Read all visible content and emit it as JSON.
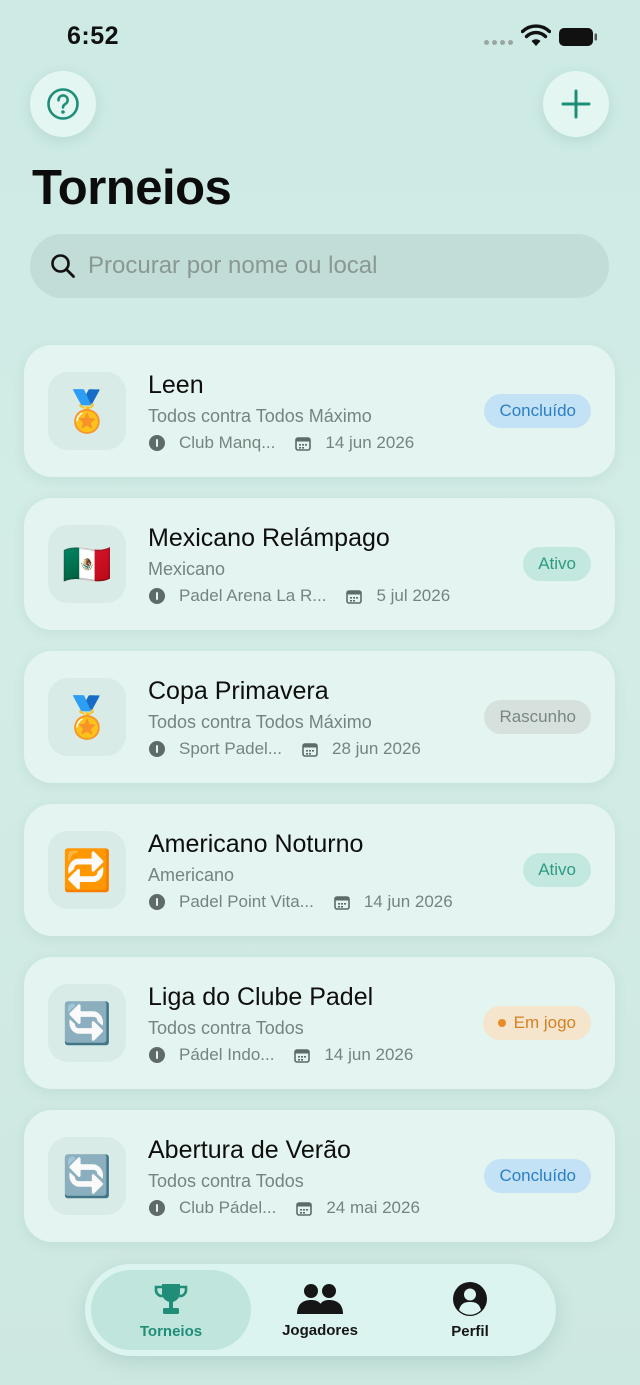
{
  "status_bar": {
    "time": "6:52"
  },
  "header": {
    "title": "Torneios"
  },
  "search": {
    "placeholder": "Procurar por nome ou local"
  },
  "tournaments": [
    {
      "icon": "medal-icon",
      "glyph": "🏅",
      "title": "Leen",
      "format": "Todos contra Todos Máximo",
      "venue": "Club Manq...",
      "date": "14 jun 2026",
      "status": "Concluído",
      "status_type": "done"
    },
    {
      "icon": "mexico-flag-icon",
      "glyph": "🇲🇽",
      "title": "Mexicano Relámpago",
      "format": "Mexicano",
      "venue": "Padel Arena La R...",
      "date": "5 jul 2026",
      "status": "Ativo",
      "status_type": "active"
    },
    {
      "icon": "medal-icon",
      "glyph": "🏅",
      "title": "Copa Primavera",
      "format": "Todos contra Todos Máximo",
      "venue": "Sport Padel...",
      "date": "28 jun 2026",
      "status": "Rascunho",
      "status_type": "draft"
    },
    {
      "icon": "repeat-icon",
      "glyph": "🔁",
      "title": "Americano Noturno",
      "format": "Americano",
      "venue": "Padel Point Vita...",
      "date": "14 jun 2026",
      "status": "Ativo",
      "status_type": "active"
    },
    {
      "icon": "refresh-icon",
      "glyph": "🔄",
      "title": "Liga do Clube Padel",
      "format": "Todos contra Todos",
      "venue": "Pádel Indo...",
      "date": "14 jun 2026",
      "status": "Em jogo",
      "status_type": "live"
    },
    {
      "icon": "refresh-icon",
      "glyph": "🔄",
      "title": "Abertura de Verão",
      "format": "Todos contra Todos",
      "venue": "Club Pádel...",
      "date": "24 mai 2026",
      "status": "Concluído",
      "status_type": "done"
    }
  ],
  "tab_bar": {
    "items": [
      {
        "label": "Torneios",
        "icon": "trophy-icon",
        "selected": true
      },
      {
        "label": "Jogadores",
        "icon": "people-icon",
        "selected": false
      },
      {
        "label": "Perfil",
        "icon": "person-circle-icon",
        "selected": false
      }
    ]
  },
  "colors": {
    "accent": "#1f8d78",
    "background": "#d3ece6",
    "card": "#e4f4f0"
  }
}
